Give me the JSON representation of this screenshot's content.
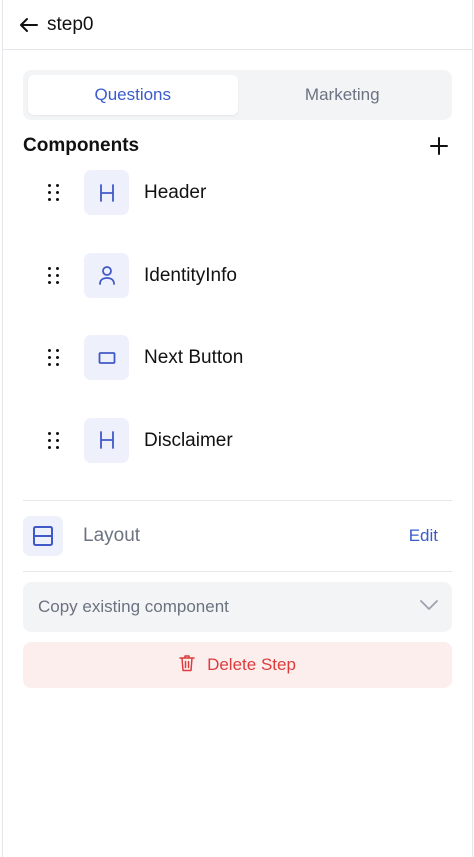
{
  "header": {
    "title": "step0",
    "back_icon": "arrow-left-icon"
  },
  "tabs": [
    {
      "label": "Questions",
      "active": true
    },
    {
      "label": "Marketing",
      "active": false
    }
  ],
  "components_section": {
    "title": "Components",
    "add_icon": "plus-icon"
  },
  "components": [
    {
      "label": "Header",
      "icon": "H",
      "icon_name": "heading-icon"
    },
    {
      "label": "IdentityInfo",
      "icon": "user",
      "icon_name": "user-icon"
    },
    {
      "label": "Next Button",
      "icon": "rect",
      "icon_name": "button-icon"
    },
    {
      "label": "Disclaimer",
      "icon": "H",
      "icon_name": "heading-icon"
    }
  ],
  "layout": {
    "label": "Layout",
    "edit_label": "Edit",
    "icon_name": "layout-icon"
  },
  "copy_select": {
    "placeholder": "Copy existing component",
    "icon_name": "chevron-down-icon"
  },
  "delete": {
    "label": "Delete Step",
    "icon_name": "trash-icon"
  },
  "colors": {
    "accent": "#3b5bcc",
    "danger": "#dc3c3c",
    "danger_bg": "#fdeeee",
    "muted_bg": "#f3f4f6",
    "icon_bg": "#eef1fb"
  }
}
